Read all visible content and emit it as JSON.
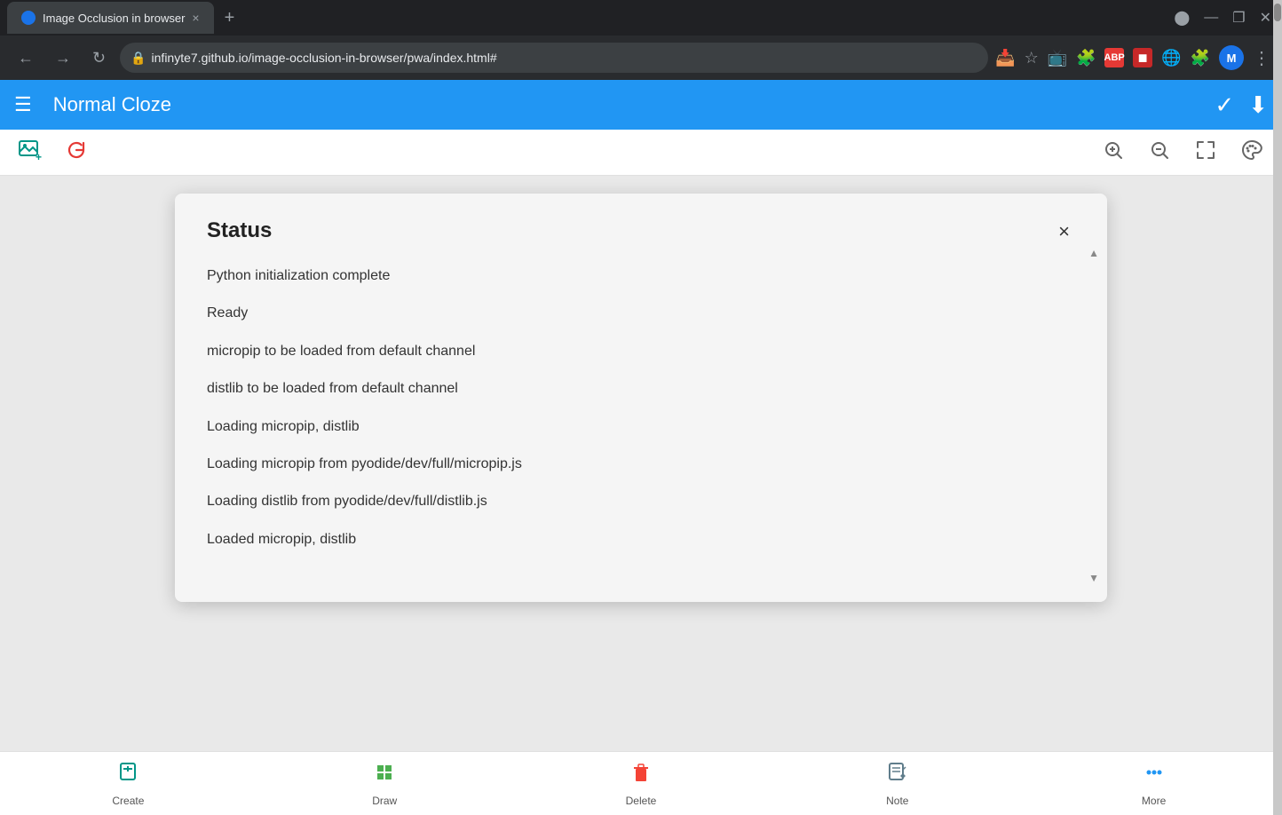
{
  "browser": {
    "tab_title": "Image Occlusion in browser",
    "tab_close": "×",
    "new_tab": "+",
    "url": "infinyte7.github.io/image-occlusion-in-browser/pwa/index.html#",
    "lock_icon": "🔒",
    "nav_back": "←",
    "nav_forward": "→",
    "nav_refresh": "↻",
    "profile_letter": "M",
    "window_minimize": "—",
    "window_maximize": "❐",
    "window_close": "✕"
  },
  "app_header": {
    "title": "Normal Cloze",
    "hamburger": "☰",
    "check_icon": "✓",
    "download_icon": "⬇"
  },
  "toolbar": {
    "add_image_title": "add-image",
    "refresh_title": "refresh",
    "zoom_in": "zoom-in",
    "zoom_out": "zoom-out",
    "fullscreen": "fullscreen",
    "palette": "palette"
  },
  "status_dialog": {
    "title": "Status",
    "close": "×",
    "items": [
      "Python initialization complete",
      "Ready",
      "micropip to be loaded from default channel",
      "distlib to be loaded from default channel",
      "Loading micropip, distlib",
      "Loading micropip from pyodide/dev/full/micropip.js",
      "Loading distlib from pyodide/dev/full/distlib.js",
      "Loaded micropip, distlib"
    ]
  },
  "bottom_nav": {
    "items": [
      {
        "label": "Create",
        "icon": "create"
      },
      {
        "label": "Draw",
        "icon": "draw"
      },
      {
        "label": "Delete",
        "icon": "delete"
      },
      {
        "label": "Note",
        "icon": "note"
      },
      {
        "label": "More",
        "icon": "more"
      }
    ]
  }
}
